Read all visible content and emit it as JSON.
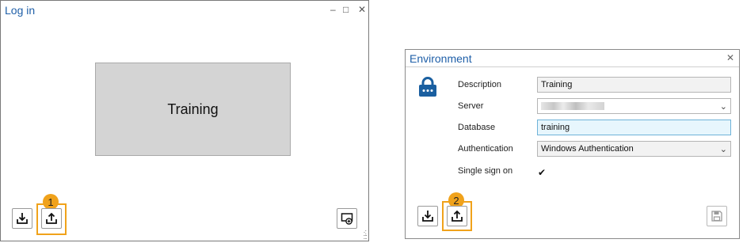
{
  "login_window": {
    "title": "Log in",
    "controls": {
      "minimize": "‒",
      "maximize": "□",
      "close": "✕"
    },
    "tile_label": "Training",
    "badge": "1",
    "buttons": {
      "import_icon": "download-icon",
      "export_icon": "upload-icon",
      "add_icon": "add-monitor-icon"
    }
  },
  "environment_dialog": {
    "title": "Environment",
    "close": "✕",
    "badge": "2",
    "fields": {
      "description_label": "Description",
      "description_value": "Training",
      "server_label": "Server",
      "database_label": "Database",
      "database_value": "training",
      "authentication_label": "Authentication",
      "authentication_value": "Windows Authentication",
      "sso_label": "Single sign on",
      "sso_checked": "✔"
    },
    "buttons": {
      "import_icon": "download-icon",
      "export_icon": "upload-icon",
      "save_icon": "save-icon"
    }
  },
  "colors": {
    "title_blue": "#1f5fa8",
    "highlight_orange": "#f0a21b",
    "lock_blue": "#1a5fa0"
  }
}
